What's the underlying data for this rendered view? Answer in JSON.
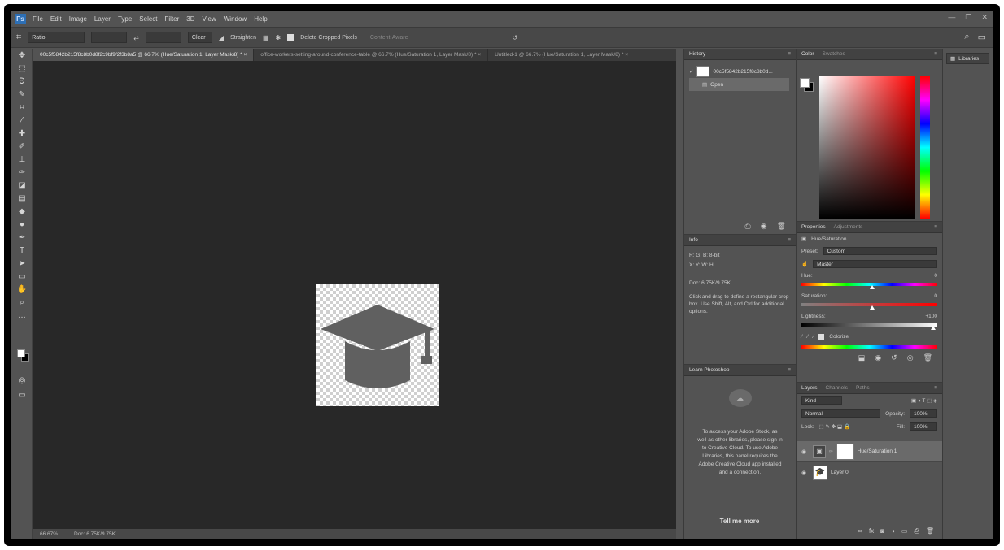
{
  "app": {
    "logo": "Ps",
    "menu": [
      "File",
      "Edit",
      "Image",
      "Layer",
      "Type",
      "Select",
      "Filter",
      "3D",
      "View",
      "Window",
      "Help"
    ],
    "window_controls": [
      "—",
      "❐",
      "✕"
    ]
  },
  "options_bar": {
    "preset_value": "Ratio",
    "clear_label": "Clear",
    "straighten_label": "Straighten",
    "delete_cropped_label": "Delete Cropped Pixels",
    "content_aware_label": "Content-Aware"
  },
  "tabs": [
    {
      "label": "00c5f5842b215f8c8b0d8f2c9bf9f2f3b8a5 @ 66.7% (Hue/Saturation 1, Layer Mask/8) *  ×",
      "active": true
    },
    {
      "label": "office-workers-setting-around-conference-table @ 66.7% (Hue/Saturation 1, Layer Mask/8) *  ×",
      "active": false
    },
    {
      "label": "Untitled-1 @ 66.7% (Hue/Saturation 1, Layer Mask/8) *  ×",
      "active": false
    }
  ],
  "status_bar": {
    "zoom": "66.67%",
    "doc_size": "Doc: 6.75K/9.75K"
  },
  "history_panel": {
    "title": "History",
    "rows": [
      {
        "label": "00c5f5842b215f8c8b0d...",
        "selected": false
      },
      {
        "label": "Open",
        "selected": true
      }
    ]
  },
  "info_panel": {
    "title": "Info",
    "lines": [
      "R:  G:  B:  8-bit",
      "X:  Y:  W:  H:",
      "Doc: 6.75K/9.75K",
      "Click and drag to define a rectangular crop box. Use Shift, Alt, and Ctrl for additional options."
    ]
  },
  "learn_panel": {
    "title": "Learn Photoshop",
    "body": "To access your Adobe Stock, as well as other libraries, please sign in to Creative Cloud. To use Adobe Libraries, this panel requires the Adobe Creative Cloud app installed and a connection.",
    "dim_text": "",
    "button": "Tell me more"
  },
  "color_panel": {
    "tabs": [
      "Color",
      "Swatches"
    ],
    "fg": "#ffffff",
    "bg": "#000000"
  },
  "properties_panel": {
    "tabs": [
      "Properties",
      "Adjustments"
    ],
    "heading": "Hue/Saturation",
    "preset_label": "Preset:",
    "preset_value": "Custom",
    "channel_value": "Master",
    "hue_label": "Hue:",
    "hue_value": "0",
    "saturation_label": "Saturation:",
    "saturation_value": "0",
    "lightness_label": "Lightness:",
    "lightness_value": "+100",
    "colorize_label": "Colorize"
  },
  "layers_panel": {
    "tabs": [
      "Layers",
      "Channels",
      "Paths"
    ],
    "filter_value": "Kind",
    "blend_value": "Normal",
    "opacity_label": "Opacity:",
    "opacity_value": "100%",
    "lock_label": "Lock:",
    "fill_label": "Fill:",
    "fill_value": "100%",
    "layers": [
      {
        "name": "Hue/Saturation 1",
        "selected": true
      },
      {
        "name": "Layer 0",
        "selected": false
      }
    ]
  },
  "libraries_panel": {
    "button": "Libraries"
  }
}
